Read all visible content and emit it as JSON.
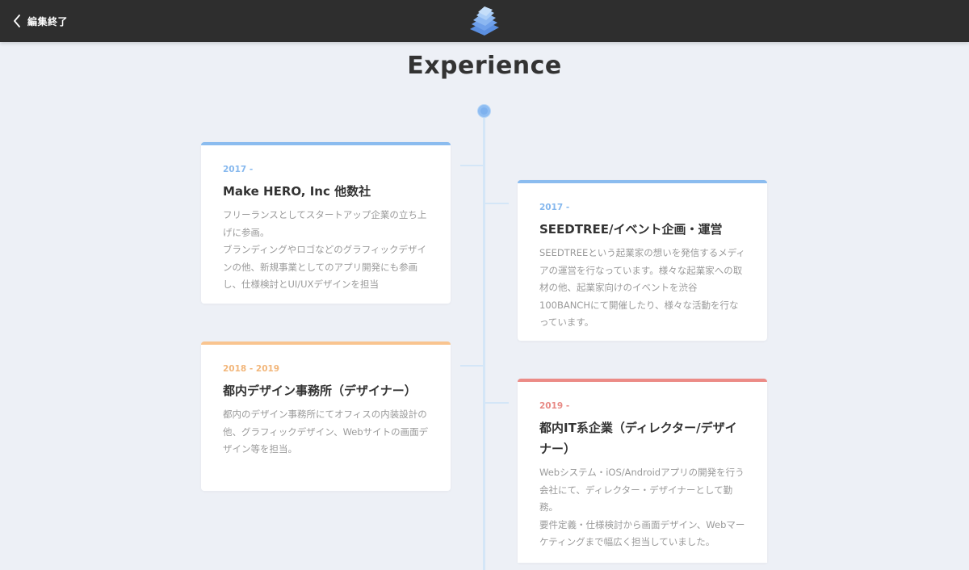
{
  "header": {
    "back_label": "編集終了",
    "logo_icon": "stacked-pages-logo-icon"
  },
  "page": {
    "title": "Experience"
  },
  "colors": {
    "accent_blue": "#8bbcef",
    "accent_orange": "#f9c48f",
    "accent_red": "#ec8b86",
    "topbar": "#2e2e2e",
    "background": "#edf0f6"
  },
  "experiences": [
    {
      "period": "2017 -",
      "title": "Make HERO, Inc 他数社",
      "description": "フリーランスとしてスタートアップ企業の立ち上げに参画。\nブランディングやロゴなどのグラフィックデザインの他、新規事業としてのアプリ開発にも参画し、仕様検討とUI/UXデザインを担当"
    },
    {
      "period": "2017 -",
      "title": "SEEDTREE/イベント企画・運営",
      "description": "SEEDTREEという起業家の想いを発信するメディアの運営を行なっています。様々な起業家への取材の他、起業家向けのイベントを渋谷100BANCHにて開催したり、様々な活動を行なっています。"
    },
    {
      "period": "2018 - 2019",
      "title": "都内デザイン事務所（デザイナー）",
      "description": "都内のデザイン事務所にてオフィスの内装設計の他、グラフィックデザイン、Webサイトの画面デザイン等を担当。"
    },
    {
      "period": "2019 -",
      "title": "都内IT系企業（ディレクター/デザイナー）",
      "description": "Webシステム・iOS/Androidアプリの開発を行う会社にて、ディレクター・デザイナーとして勤務。\n要件定義・仕様検討から画面デザイン、Webマーケティングまで幅広く担当していました。"
    }
  ]
}
